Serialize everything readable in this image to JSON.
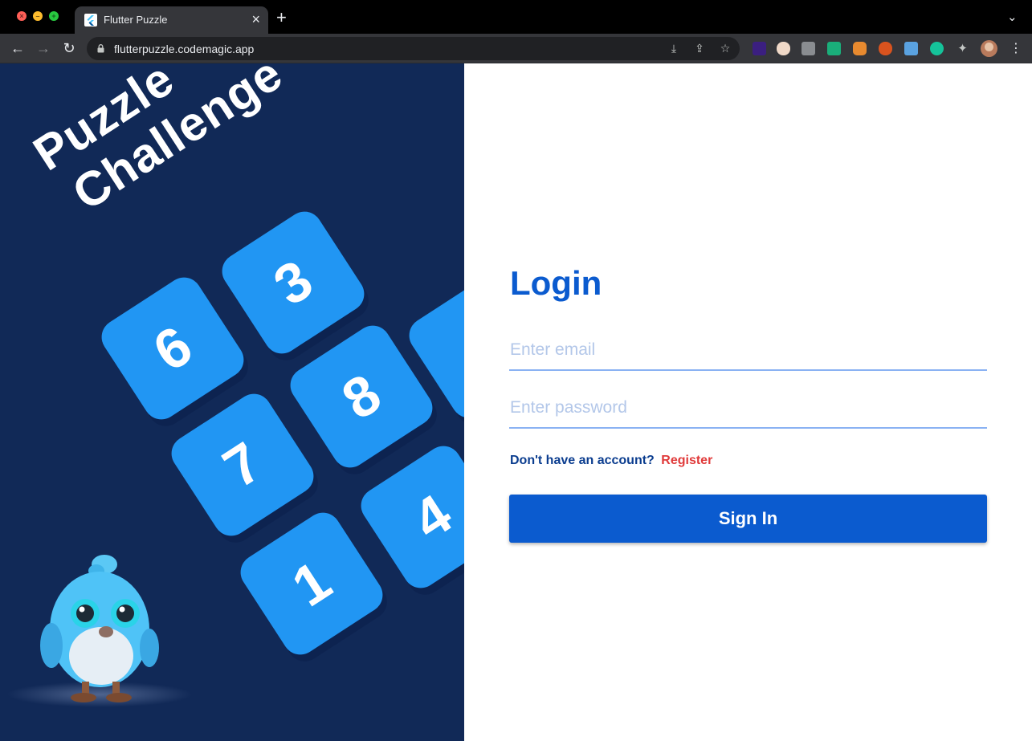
{
  "browser": {
    "tab_title": "Flutter Puzzle",
    "url": "flutterpuzzle.codemagic.app"
  },
  "hero": {
    "title_line1": "Puzzle",
    "title_line2": "Challenge",
    "tiles": [
      "6",
      "3",
      "8",
      "7",
      "4",
      "1"
    ]
  },
  "login": {
    "title": "Login",
    "email_placeholder": "Enter email",
    "password_placeholder": "Enter password",
    "register_question": "Don't have an account?",
    "register_link": "Register",
    "sign_in_label": "Sign In"
  },
  "colors": {
    "panel_bg": "#112957",
    "tile": "#2196f3",
    "primary": "#0b5bcf",
    "link": "#e03a3a"
  }
}
